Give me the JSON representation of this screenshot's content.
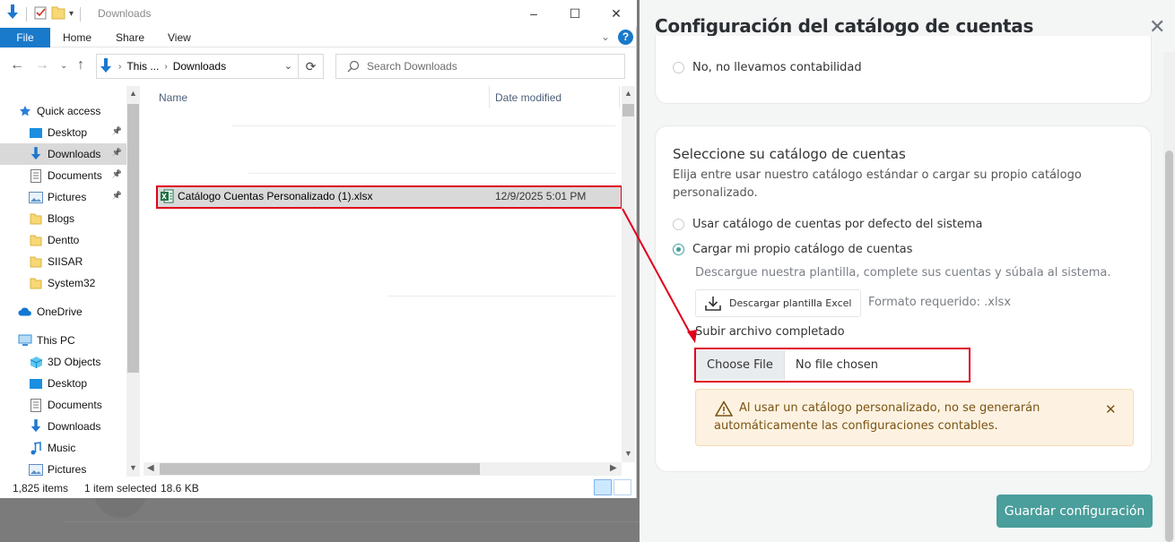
{
  "explorer": {
    "title": "Downloads",
    "ribbon_tabs": [
      "File",
      "Home",
      "Share",
      "View"
    ],
    "address": {
      "crumb_parent": "This ...",
      "crumb_current": "Downloads"
    },
    "search_placeholder": "Search Downloads",
    "nav": {
      "quick_access": "Quick access",
      "quick_items": [
        {
          "label": "Desktop",
          "pinned": true
        },
        {
          "label": "Downloads",
          "pinned": true,
          "selected": true
        },
        {
          "label": "Documents",
          "pinned": true
        },
        {
          "label": "Pictures",
          "pinned": true
        },
        {
          "label": "Blogs"
        },
        {
          "label": "Dentto"
        },
        {
          "label": "SIISAR"
        },
        {
          "label": "System32"
        }
      ],
      "onedrive": "OneDrive",
      "this_pc": "This PC",
      "pc_items": [
        "3D Objects",
        "Desktop",
        "Documents",
        "Downloads",
        "Music",
        "Pictures"
      ]
    },
    "columns": {
      "name": "Name",
      "date_modified": "Date modified"
    },
    "file": {
      "name": "Catálogo Cuentas Personalizado (1).xlsx",
      "date": "12/9/2025 5:01 PM"
    },
    "status": {
      "count": "1,825 items",
      "selected": "1 item selected",
      "size": "18.6 KB"
    }
  },
  "panel": {
    "title": "Configuración del catálogo de cuentas",
    "prev_option": "No, no llevamos contabilidad",
    "section_title": "Seleccione su catálogo de cuentas",
    "section_desc": "Elija entre usar nuestro catálogo estándar o cargar su propio catálogo personalizado.",
    "option_default": "Usar catálogo de cuentas por defecto del sistema",
    "option_custom": "Cargar mi propio catálogo de cuentas",
    "selected_option": "custom",
    "hint": "Descargue nuestra plantilla, complete sus cuentas y súbala al sistema.",
    "download_label": "Descargar plantilla Excel",
    "format_note": "Formato requerido: .xlsx",
    "upload_label": "Subir archivo completado",
    "choose_file": "Choose File",
    "no_file": "No file chosen",
    "alert_text": "Al usar un catálogo personalizado, no se generarán automáticamente las configuraciones contables.",
    "save_label": "Guardar configuración"
  },
  "colors": {
    "accent": "#4a9e9b",
    "annotation": "#e0001b",
    "file_tab": "#1979ca"
  }
}
